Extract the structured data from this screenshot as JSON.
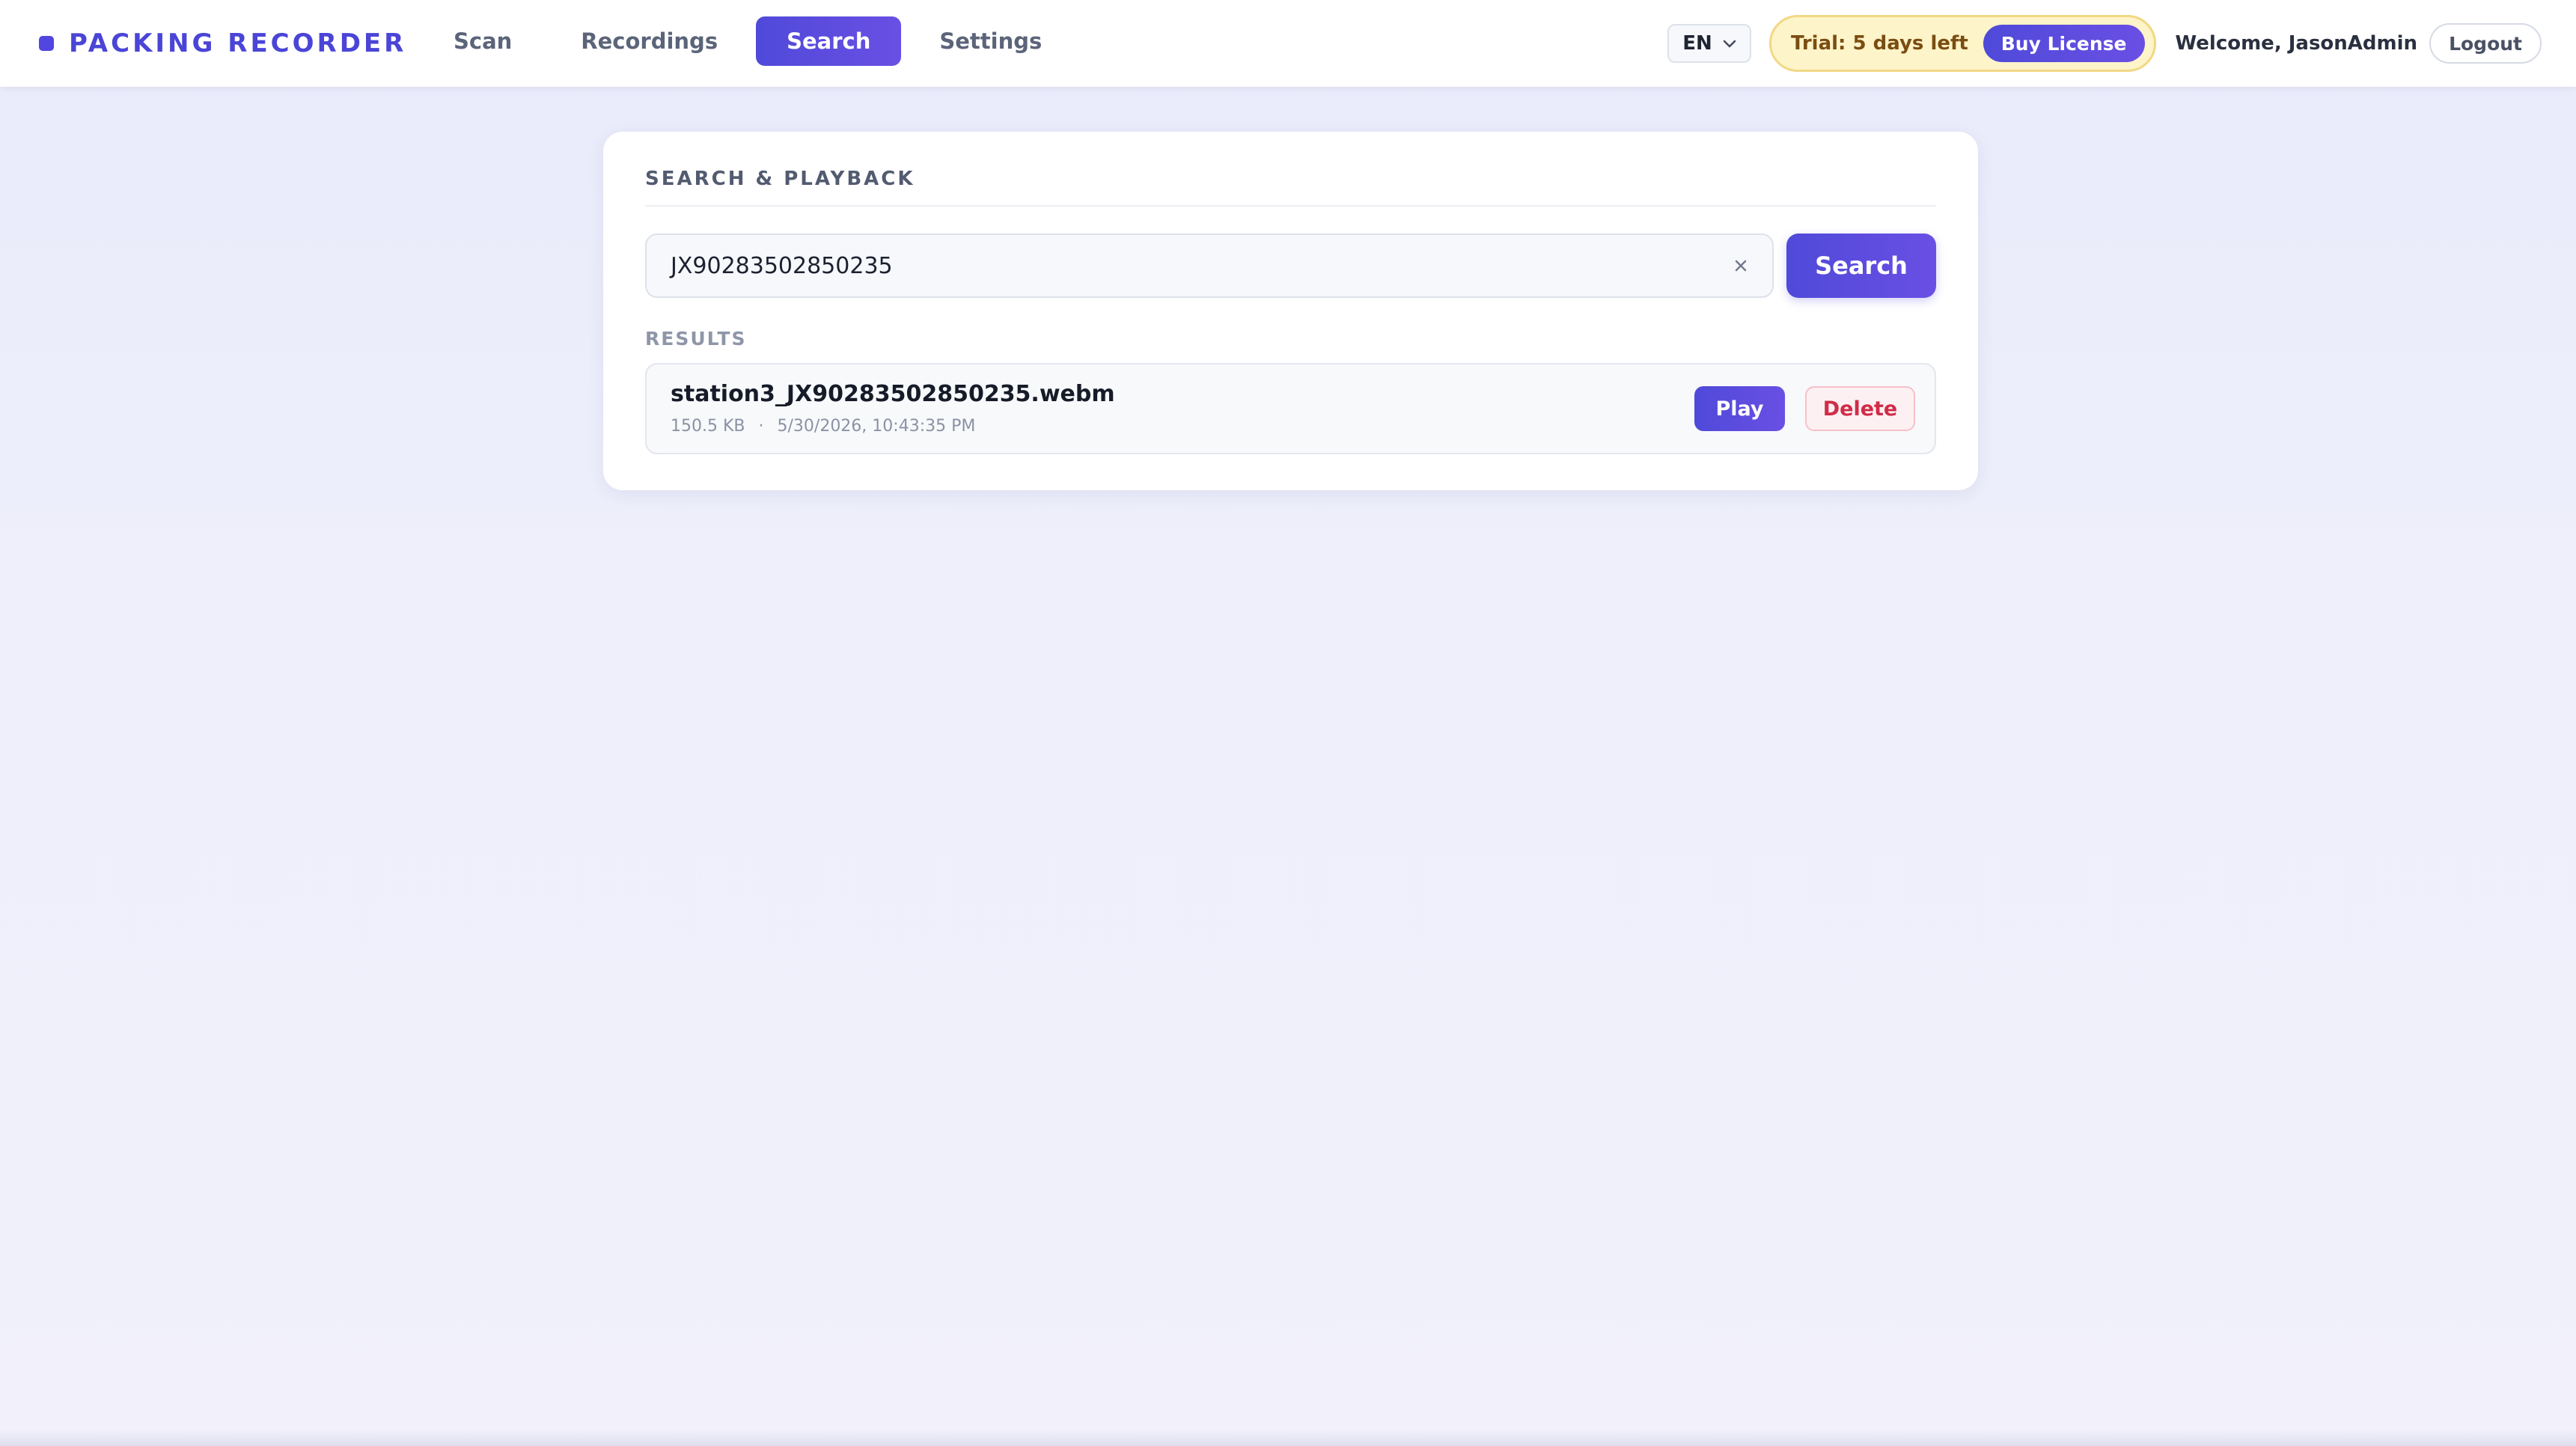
{
  "app": {
    "brand": "PACKING RECORDER"
  },
  "nav": {
    "tabs": [
      {
        "label": "Scan",
        "active": false
      },
      {
        "label": "Recordings",
        "active": false
      },
      {
        "label": "Search",
        "active": true
      },
      {
        "label": "Settings",
        "active": false
      }
    ]
  },
  "header": {
    "language": "EN",
    "trial_text": "Trial: 5 days left",
    "buy_label": "Buy License",
    "welcome": "Welcome, JasonAdmin",
    "logout_label": "Logout"
  },
  "search": {
    "title": "SEARCH & PLAYBACK",
    "query": "JX90283502850235",
    "button_label": "Search",
    "results_label": "RESULTS",
    "results": [
      {
        "file_name": "station3_JX90283502850235.webm",
        "size": "150.5 KB",
        "timestamp": "5/30/2026, 10:43:35 PM",
        "play_label": "Play",
        "delete_label": "Delete"
      }
    ]
  },
  "colors": {
    "accent": "#5146e0",
    "trial_bg": "#fdf4c9",
    "trial_text": "#7a4d12",
    "danger": "#cf2c48"
  },
  "icons": {
    "clear": "close-icon",
    "language_chevron": "chevron-down-icon"
  }
}
